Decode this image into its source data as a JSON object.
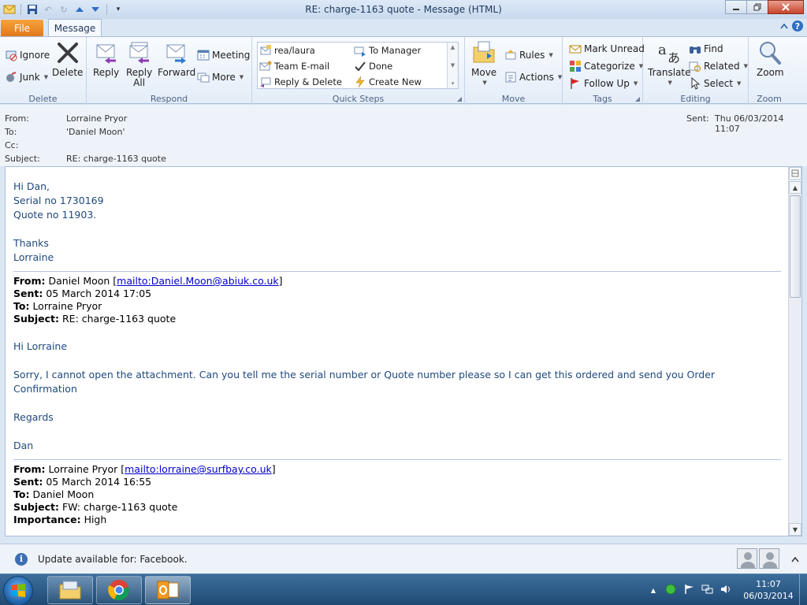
{
  "window": {
    "title": "RE: charge-1163 quote - Message (HTML)"
  },
  "tabs": {
    "file": "File",
    "message": "Message"
  },
  "ribbon": {
    "delete_group": {
      "label": "Delete",
      "ignore": "Ignore",
      "junk": "Junk",
      "delete": "Delete"
    },
    "respond_group": {
      "label": "Respond",
      "reply": "Reply",
      "reply_all_1": "Reply",
      "reply_all_2": "All",
      "forward": "Forward",
      "meeting": "Meeting",
      "more": "More"
    },
    "quicksteps_group": {
      "label": "Quick Steps",
      "items": [
        "rea/laura",
        "To Manager",
        "Team E-mail",
        "Done",
        "Reply & Delete",
        "Create New"
      ]
    },
    "move_group": {
      "label": "Move",
      "move": "Move",
      "rules": "Rules",
      "actions": "Actions"
    },
    "tags_group": {
      "label": "Tags",
      "mark_unread": "Mark Unread",
      "categorize": "Categorize",
      "follow_up": "Follow Up"
    },
    "editing_group": {
      "label": "Editing",
      "translate": "Translate",
      "find": "Find",
      "related": "Related",
      "select": "Select"
    },
    "zoom_group": {
      "label": "Zoom",
      "zoom": "Zoom"
    }
  },
  "header": {
    "from_label": "From:",
    "from_value": "Lorraine Pryor",
    "to_label": "To:",
    "to_value": "'Daniel Moon'",
    "cc_label": "Cc:",
    "subject_label": "Subject:",
    "subject_value": "RE: charge-1163 quote",
    "sent_label": "Sent:",
    "sent_value": "Thu 06/03/2014 11:07"
  },
  "body": {
    "greeting": "Hi Dan,",
    "line1": "Serial no 1730169",
    "line2": "Quote no 11903.",
    "thanks": "Thanks",
    "signoff": "Lorraine",
    "reply1": {
      "from_label": "From:",
      "from_name": "Daniel Moon [",
      "from_link": "mailto:Daniel.Moon@abiuk.co.uk",
      "from_close": "]",
      "sent_label": "Sent:",
      "sent_value": "05 March 2014 17:05",
      "to_label": "To:",
      "to_value": "Lorraine Pryor",
      "subject_label": "Subject:",
      "subject_value": "RE: charge-1163 quote",
      "greeting": "Hi Lorraine",
      "text": "Sorry, I cannot open the attachment. Can you tell me the serial number or Quote number please so I can get this ordered and send you Order Confirmation",
      "regards": "Regards",
      "name": "Dan"
    },
    "reply2": {
      "from_label": "From:",
      "from_name": "Lorraine Pryor [",
      "from_link": "mailto:lorraine@surfbay.co.uk",
      "from_close": "]",
      "sent_label": "Sent:",
      "sent_value": "05 March 2014 16:55",
      "to_label": "To:",
      "to_value": "Daniel Moon",
      "subject_label": "Subject:",
      "subject_value": "FW: charge-1163 quote",
      "importance_label": "Importance:",
      "importance_value": "High"
    }
  },
  "people_pane": {
    "update_text": "Update available for: Facebook."
  },
  "taskbar": {
    "time": "11:07",
    "date": "06/03/2014"
  },
  "colors": {
    "body_text": "#1f497d",
    "link": "#0000cc",
    "file_tab": "#e0791a"
  }
}
